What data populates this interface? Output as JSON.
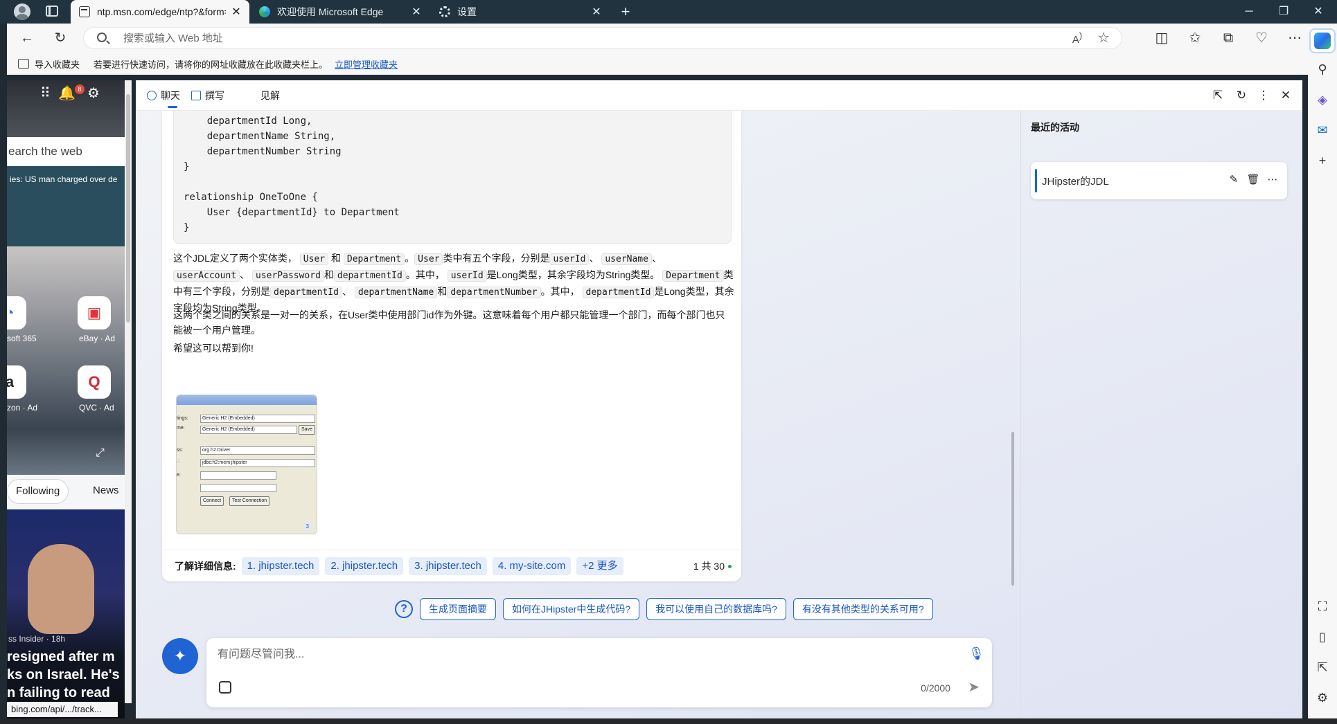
{
  "tabs": [
    {
      "title": "ntp.msn.com/edge/ntp?&form=I",
      "active": true
    },
    {
      "title": "欢迎使用 Microsoft Edge",
      "active": false
    },
    {
      "title": "设置",
      "active": false
    }
  ],
  "address": {
    "placeholder": "搜索或输入 Web 地址"
  },
  "favbar": {
    "import_label": "导入收藏夹",
    "message": "若要进行快速访问，请将你的网址收藏放在此收藏夹栏上。",
    "manage_link": "立即管理收藏夹"
  },
  "msn": {
    "notification_count": "8",
    "search_placeholder": "earch the web",
    "ticker": "ies: US man charged over de",
    "tiles": [
      {
        "label": "soft 365"
      },
      {
        "label": "eBay · Ad"
      },
      {
        "label": "zon · Ad"
      },
      {
        "label": "QVC · Ad"
      }
    ],
    "pills": [
      "Following",
      "News"
    ],
    "news_source": "ss Insider · 18h",
    "headline": "resigned after m\nks on Israel. He's\nn failing to read",
    "status_url": "bing.com/api/.../track..."
  },
  "copilot": {
    "tabs": [
      "聊天",
      "撰写",
      "见解"
    ],
    "code_lines": [
      "    departmentId Long,",
      "    departmentName String,",
      "    departmentNumber String",
      "}",
      "",
      "relationship OneToOne {",
      "    User {departmentId} to Department",
      "}"
    ],
    "para1_parts": {
      "a": "这个JDL定义了两个实体类，",
      "c1": "User",
      "b": "和",
      "c2": "Department",
      "d": "。",
      "c3": "User",
      "e": "类中有五个字段，分别是",
      "c4": "userId",
      "f": "、",
      "c5": "userName",
      "g": "、",
      "c6": "userAccount",
      "h": "、",
      "c7": "userPassword",
      "i": "和",
      "c8": "departmentId",
      "j": "。其中，",
      "c9": "userId",
      "k": "是Long类型，其余字段均为String类型。",
      "c10": "Department",
      "l": "类中有三个字段，分别是",
      "c11": "departmentId",
      "m": "、",
      "c12": "departmentName",
      "n": "和",
      "c13": "departmentNumber",
      "o": "。其中，",
      "c14": "departmentId",
      "p": "是Long类型，其余字段均为String类型。"
    },
    "para2": "这两个类之间的关系是一对一的关系，在User类中使用部门id作为外键。这意味着每个用户都只能管理一个部门，而每个部门也只能被一个用户管理。",
    "para3": "希望这可以帮到你!",
    "screenshot": {
      "rows": [
        "tings:",
        "me:",
        "ss:",
        ".:",
        "e:"
      ],
      "fields": [
        "Generic H2 (Embedded)",
        "Generic H2 (Embedded)",
        "org.h2.Driver",
        "jdbc:h2:mem:jhipster",
        "",
        ""
      ],
      "save": "Save",
      "connect": "Connect",
      "test": "Test Connection",
      "num": "3"
    },
    "refs_label": "了解详细信息:",
    "refs": [
      "1. jhipster.tech",
      "2. jhipster.tech",
      "3. jhipster.tech",
      "4. my-site.com",
      "+2 更多"
    ],
    "page_count": "1 共 30",
    "suggestions": [
      "生成页面摘要",
      "如何在JHipster中生成代码?",
      "我可以使用自己的数据库吗?",
      "有没有其他类型的关系可用?"
    ],
    "input_placeholder": "有问题尽管问我...",
    "char_count": "0/2000",
    "history_title": "最近的活动",
    "history_items": [
      "JHipster的JDL"
    ]
  }
}
